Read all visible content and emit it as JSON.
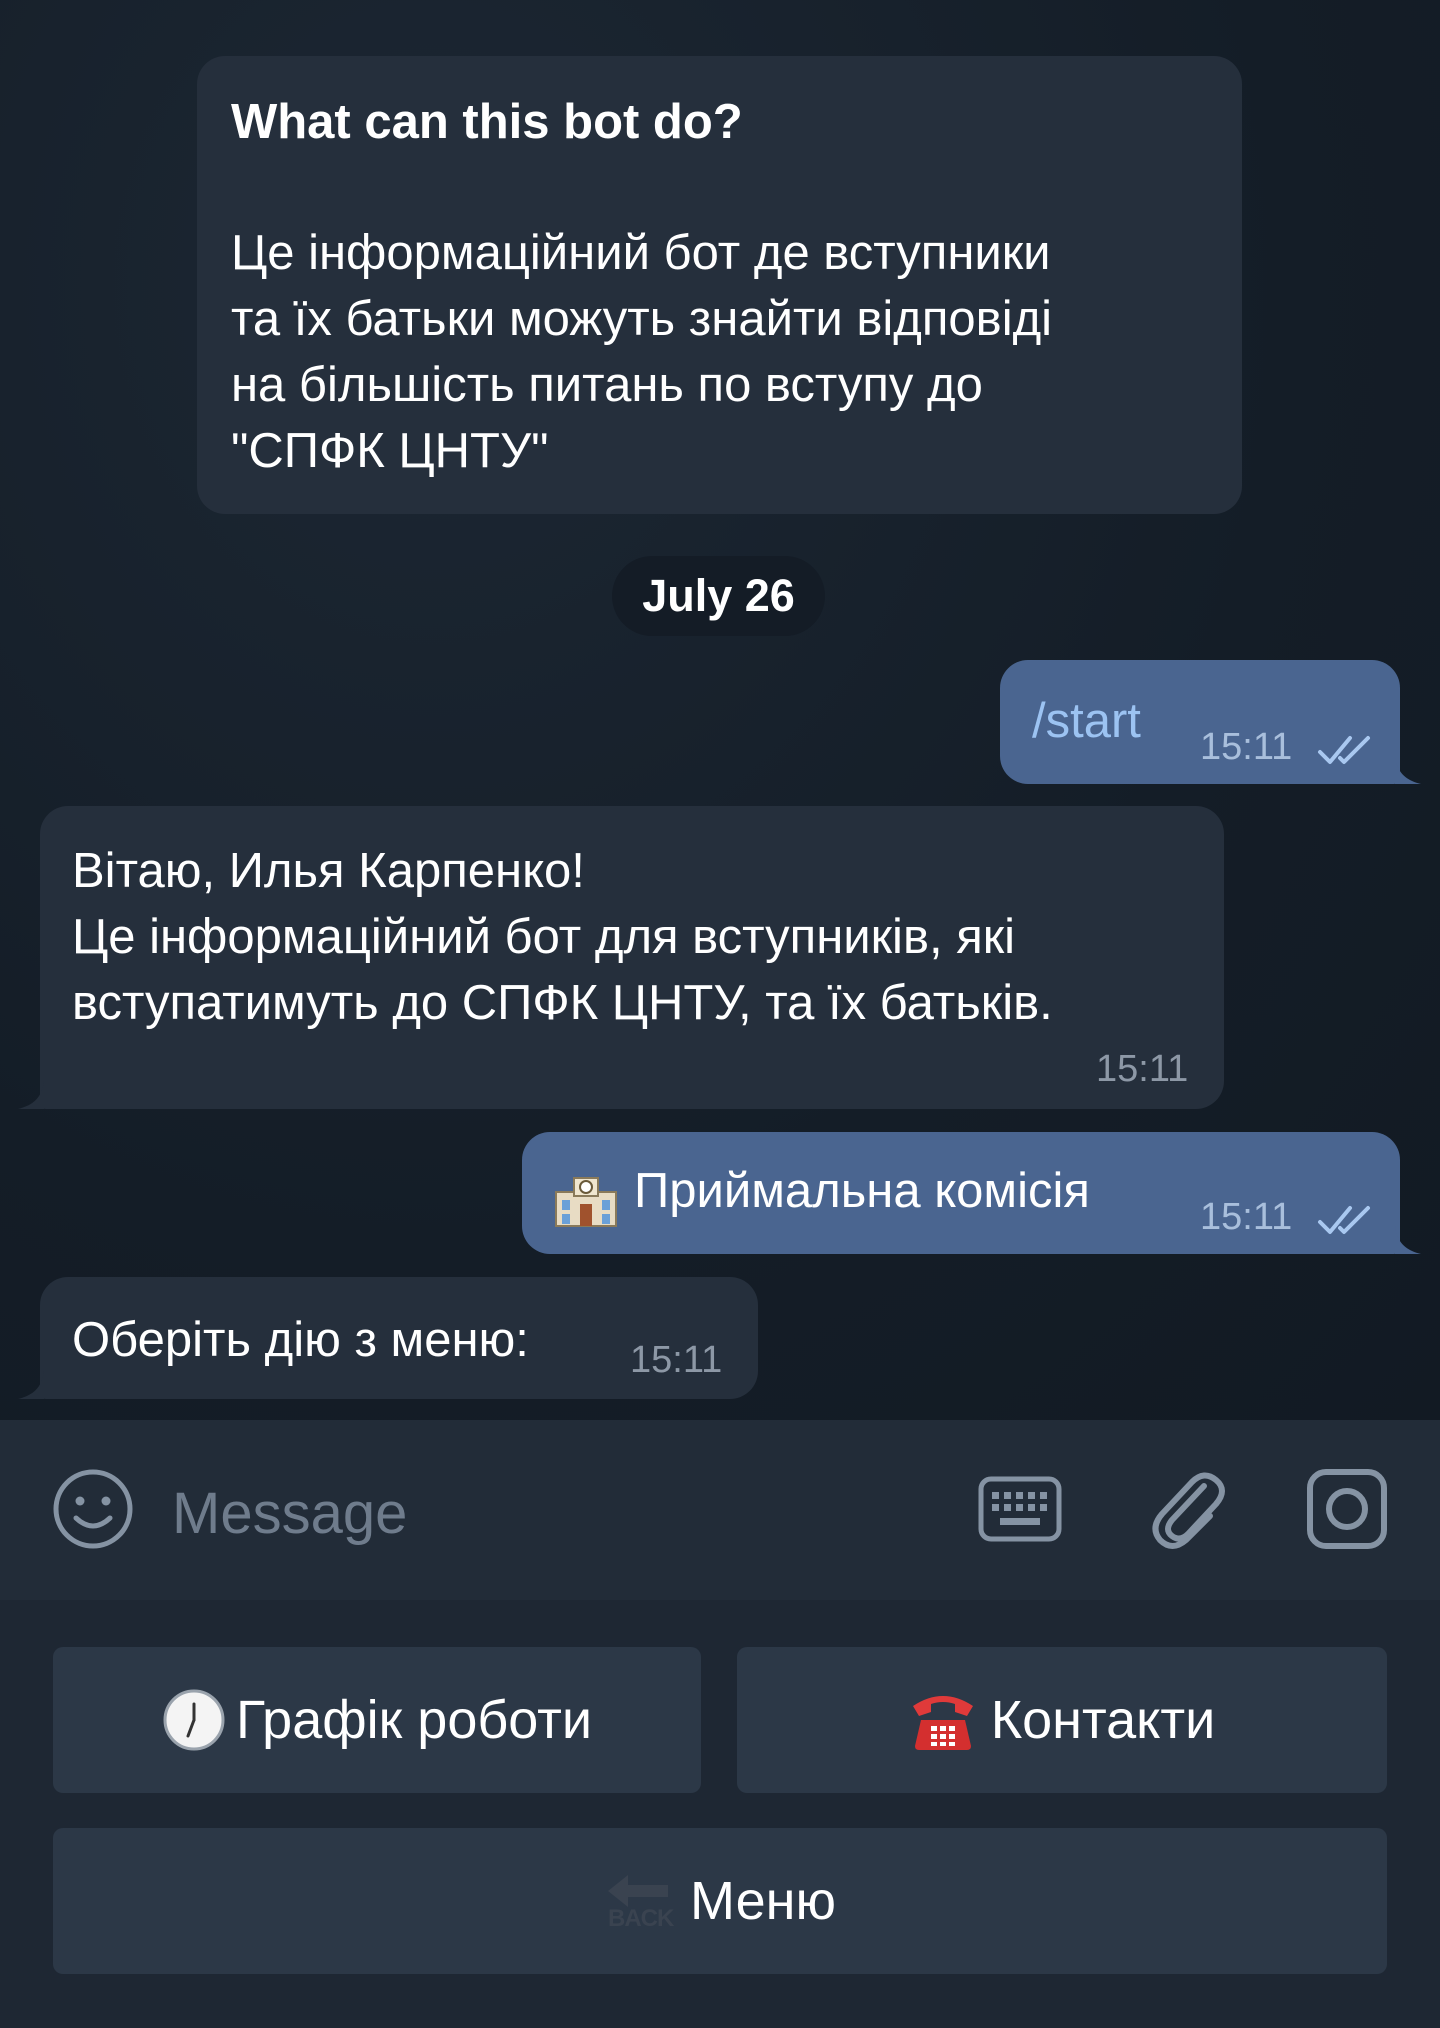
{
  "intro": {
    "title": "What can this bot do?",
    "body": "Це інформаційний бот де вступники\nта їх батьки можуть знайти відповіді\nна більшість питань по вступу до\n\"СПФК ЦНТУ\""
  },
  "date_chip": "July 26",
  "messages": [
    {
      "direction": "out",
      "text": "/start",
      "time": "15:11",
      "status": "read"
    },
    {
      "direction": "in",
      "text": "Вітаю, Илья Карпенко!\nЦе інформаційний бот для вступників, які\nвступатимуть до СПФК ЦНТУ, та їх батьків.",
      "time": "15:11"
    },
    {
      "direction": "out",
      "text": "Приймальна комісія",
      "emoji": "school-building",
      "time": "15:11",
      "status": "read"
    },
    {
      "direction": "in",
      "text": "Оберіть дію з меню:",
      "time": "15:11"
    }
  ],
  "input": {
    "placeholder": "Message",
    "icons": [
      "emoji-icon",
      "keyboard-icon",
      "attach-icon",
      "camera-icon"
    ]
  },
  "keyboard": {
    "buttons": [
      {
        "label": "Графік роботи",
        "icon": "clock-icon"
      },
      {
        "label": "Контакти",
        "icon": "telephone-icon"
      },
      {
        "label": "Меню",
        "icon": "back-arrow-icon",
        "icon_text": "BACK"
      }
    ]
  },
  "colors": {
    "background": "#18222d",
    "incoming_bubble": "#252f3c",
    "outgoing_bubble": "#4a6590",
    "tick": "#a9c8f0"
  }
}
